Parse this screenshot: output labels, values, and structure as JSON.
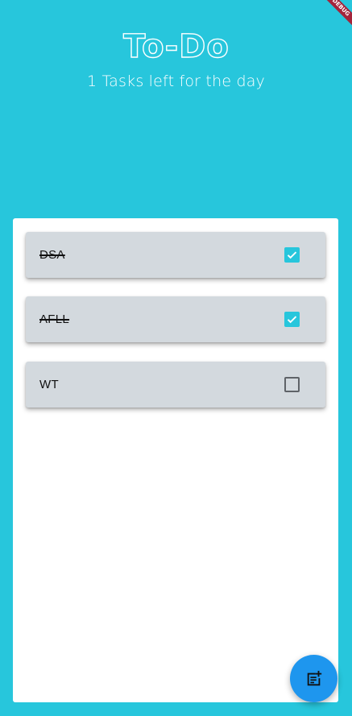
{
  "app": {
    "title": "To-Do",
    "subtitle": "1 Tasks left for the day",
    "debug_banner": "DEBUG"
  },
  "colors": {
    "background": "#27c6dc",
    "panel": "#ffffff",
    "card": "#d3d9de",
    "checked": "#27c6dc",
    "fab": "#1e96ee"
  },
  "tasks": [
    {
      "label": "DSA",
      "done": true
    },
    {
      "label": "AFLL",
      "done": true
    },
    {
      "label": "WT",
      "done": false
    }
  ],
  "fab": {
    "icon": "add-note-icon"
  }
}
